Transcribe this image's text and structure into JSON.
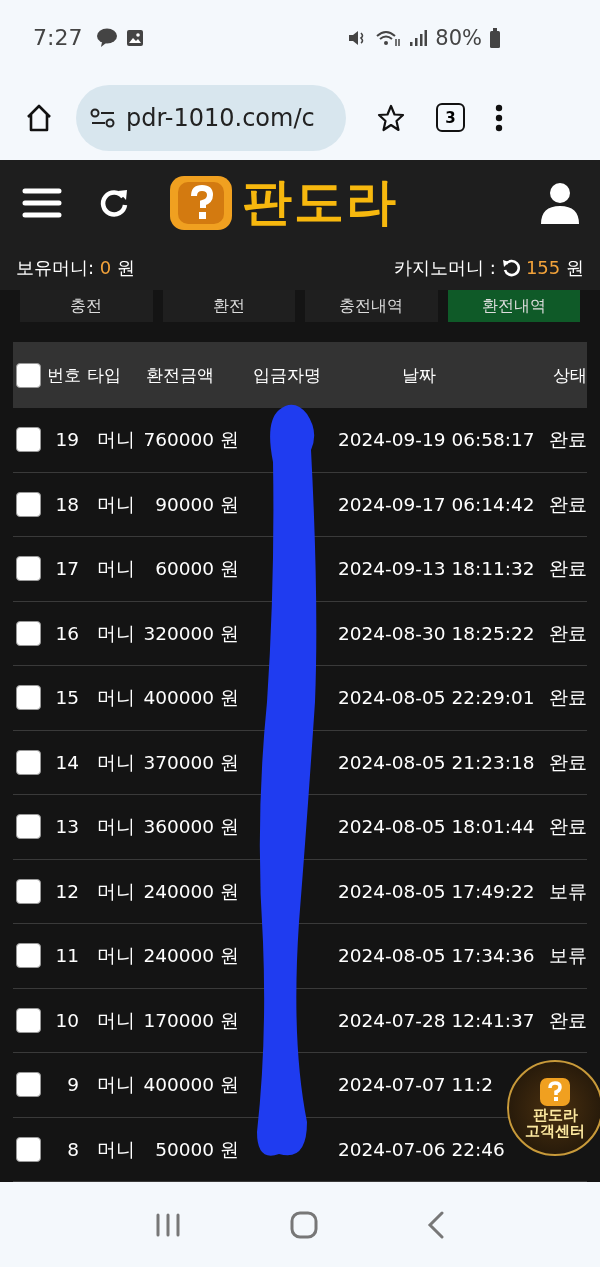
{
  "status_bar": {
    "time": "7:27",
    "battery": "80%"
  },
  "browser": {
    "url": "pdr-1010.com/c",
    "tab_count": "3"
  },
  "header": {
    "logo": "판도라"
  },
  "balances": {
    "money_label": "보유머니:",
    "money_value": "0",
    "money_unit": "원",
    "casino_label": "카지노머니 :",
    "casino_value": "155",
    "casino_unit": "원"
  },
  "tabs": [
    {
      "label": "충전",
      "selected": false
    },
    {
      "label": "환전",
      "selected": false
    },
    {
      "label": "충전내역",
      "selected": false
    },
    {
      "label": "환전내역",
      "selected": true
    }
  ],
  "table": {
    "columns": [
      "번호",
      "타입",
      "환전금액",
      "입금자명",
      "날짜",
      "상태"
    ],
    "all_checked": false,
    "rows": [
      {
        "checked": false,
        "no": "19",
        "type": "머니",
        "amount": "760000 원",
        "date": "2024-09-19 06:58:17",
        "status": "완료"
      },
      {
        "checked": false,
        "no": "18",
        "type": "머니",
        "amount": "90000 원",
        "date": "2024-09-17 06:14:42",
        "status": "완료"
      },
      {
        "checked": false,
        "no": "17",
        "type": "머니",
        "amount": "60000 원",
        "date": "2024-09-13 18:11:32",
        "status": "완료"
      },
      {
        "checked": false,
        "no": "16",
        "type": "머니",
        "amount": "320000 원",
        "date": "2024-08-30 18:25:22",
        "status": "완료"
      },
      {
        "checked": false,
        "no": "15",
        "type": "머니",
        "amount": "400000 원",
        "date": "2024-08-05 22:29:01",
        "status": "완료"
      },
      {
        "checked": false,
        "no": "14",
        "type": "머니",
        "amount": "370000 원",
        "date": "2024-08-05 21:23:18",
        "status": "완료"
      },
      {
        "checked": false,
        "no": "13",
        "type": "머니",
        "amount": "360000 원",
        "date": "2024-08-05 18:01:44",
        "status": "완료"
      },
      {
        "checked": false,
        "no": "12",
        "type": "머니",
        "amount": "240000 원",
        "date": "2024-08-05 17:49:22",
        "status": "보류"
      },
      {
        "checked": false,
        "no": "11",
        "type": "머니",
        "amount": "240000 원",
        "date": "2024-08-05 17:34:36",
        "status": "보류"
      },
      {
        "checked": false,
        "no": "10",
        "type": "머니",
        "amount": "170000 원",
        "date": "2024-07-28 12:41:37",
        "status": "완료"
      },
      {
        "checked": false,
        "no": "9",
        "type": "머니",
        "amount": "400000 원",
        "date": "2024-07-07 11:2"
      },
      {
        "checked": false,
        "no": "8",
        "type": "머니",
        "amount": "50000 원",
        "date": "2024-07-06 22:46"
      }
    ]
  },
  "support_badge": {
    "line1": "판도라",
    "line2": "고객센터"
  }
}
